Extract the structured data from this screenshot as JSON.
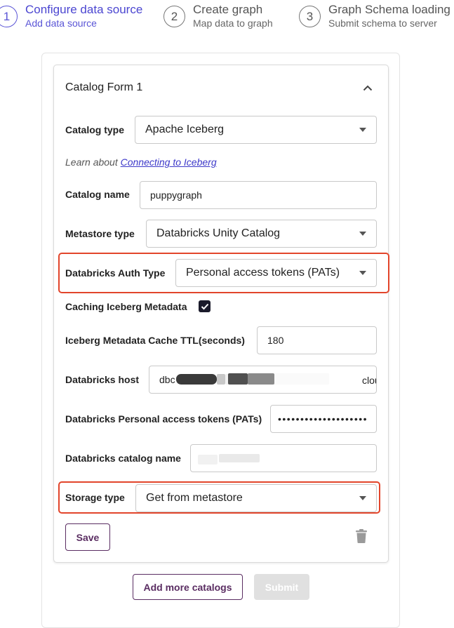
{
  "stepper": {
    "steps": [
      {
        "number": "1",
        "title": "Configure data source",
        "subtitle": "Add data source",
        "active": true
      },
      {
        "number": "2",
        "title": "Create graph",
        "subtitle": "Map data to graph",
        "active": false
      },
      {
        "number": "3",
        "title": "Graph Schema loading",
        "subtitle": "Submit schema to server",
        "active": false
      }
    ]
  },
  "form": {
    "title": "Catalog Form 1",
    "collapse_icon": "chevron-up-icon",
    "catalog_type": {
      "label": "Catalog type",
      "value": "Apache Iceberg"
    },
    "learn": {
      "prefix": "Learn about ",
      "link_text": "Connecting to Iceberg"
    },
    "catalog_name": {
      "label": "Catalog name",
      "value": "puppygraph"
    },
    "metastore_type": {
      "label": "Metastore type",
      "value": "Databricks Unity Catalog"
    },
    "auth_type": {
      "label": "Databricks Auth Type",
      "value": "Personal access tokens (PATs)"
    },
    "caching": {
      "label": "Caching Iceberg Metadata",
      "checked": true
    },
    "cache_ttl": {
      "label": "Iceberg Metadata Cache TTL(seconds)",
      "value": "180"
    },
    "host": {
      "label": "Databricks host",
      "value_start": "dbc",
      "value_end": "cloud.databricks.com"
    },
    "pat": {
      "label": "Databricks Personal access tokens (PATs)",
      "value": "••••••••••••••••••••"
    },
    "catalog_name_db": {
      "label": "Databricks catalog name",
      "value": ""
    },
    "storage_type": {
      "label": "Storage type",
      "value": "Get from metastore"
    },
    "save_label": "Save",
    "delete_icon": "trash-icon"
  },
  "actions": {
    "add_more_label": "Add more catalogs",
    "submit_label": "Submit"
  },
  "colors": {
    "accent": "#4b46d1",
    "highlight": "#e2452b",
    "button_text": "#5a2d62"
  }
}
